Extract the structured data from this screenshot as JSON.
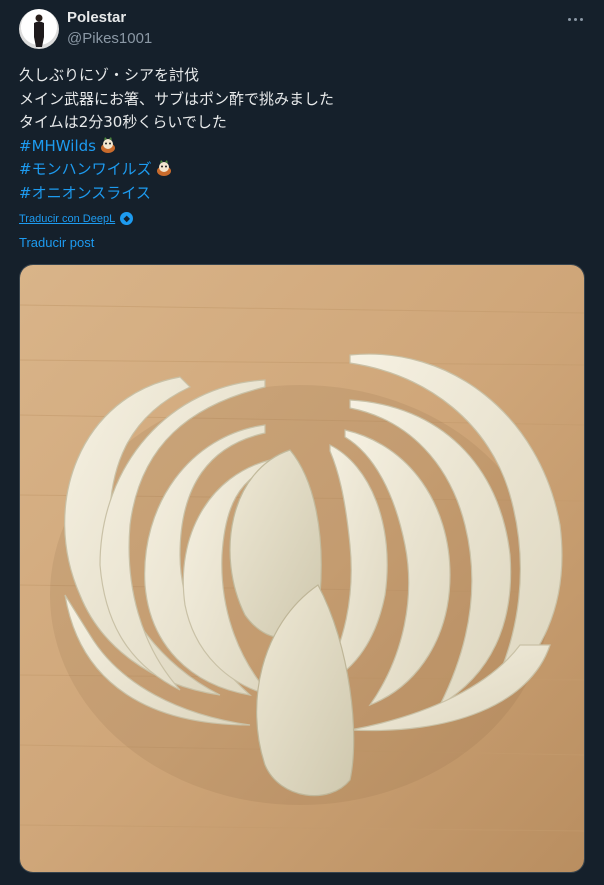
{
  "author": {
    "name": "Polestar",
    "handle": "@Pikes1001"
  },
  "tweet": {
    "lines": [
      "久しぶりにゾ・シアを討伐",
      "メイン武器にお箸、サブはポン酢で挑みました",
      "タイムは2分30秒くらいでした"
    ],
    "hashtags": [
      "#MHWilds",
      "#モンハンワイルズ",
      "#オニオンスライス"
    ]
  },
  "actions": {
    "deepl": "Traducir con DeepL",
    "translate": "Traducir post"
  },
  "colors": {
    "background": "#15202b",
    "link": "#1d9bf0",
    "muted": "#8b98a5",
    "text": "#e7e9ea"
  },
  "icons": [
    "more-options-icon",
    "mascot-emoji-icon",
    "deepl-icon"
  ]
}
